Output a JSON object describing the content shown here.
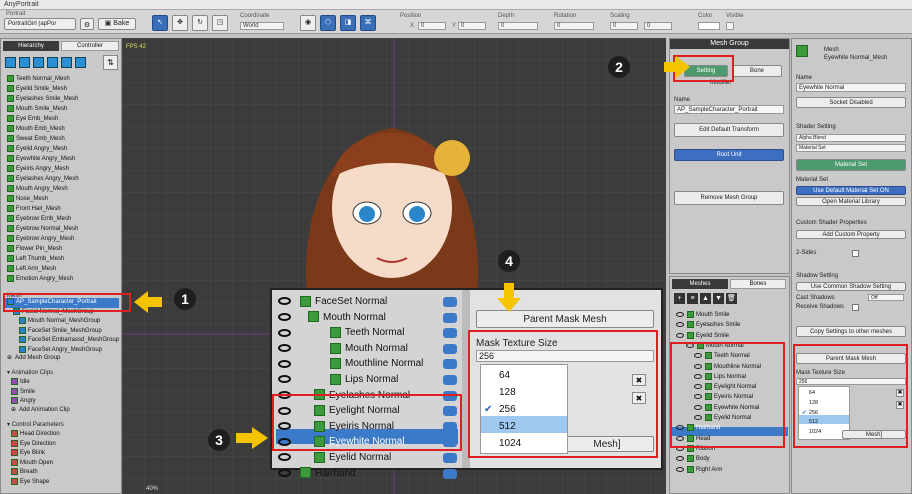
{
  "window_title": "AnyPortrait",
  "toolbar": {
    "portrait_select": "PortraitGirl (apPor",
    "bake": "Bake",
    "coordinate_label": "Coordinate",
    "coordinate_value": "World",
    "position_label": "Position",
    "depth_label": "Depth",
    "rotation_label": "Rotation",
    "scaling_label": "Scaling",
    "color_label": "Color",
    "visible_label": "Visible",
    "x": "X",
    "y": "Y",
    "zero": "0",
    "portrait_label": "Portrait"
  },
  "hierarchy": {
    "tabs": [
      "Hierarchy",
      "Controller"
    ],
    "meshes": [
      "Teeth Normal_Mesh",
      "Eyelid Smile_Mesh",
      "Eyelashes Smile_Mesh",
      "Mouth Smile_Mesh",
      "Eye Emb_Mesh",
      "Mouth Emb_Mesh",
      "Sweat Emb_Mesh",
      "Eyelid Angry_Mesh",
      "Eyewhite Angry_Mesh",
      "Eyeiris Angry_Mesh",
      "Eyelashes Angry_Mesh",
      "Mouth Angry_Mesh",
      "Nose_Mesh",
      "Front Hair_Mesh",
      "Eyebrow Emb_Mesh",
      "Eyebrow Normal_Mesh",
      "Eyebrow Angry_Mesh",
      "Flower Pin_Mesh",
      "Left Thumb_Mesh",
      "Left Arm_Mesh",
      "Emotion Angry_Mesh"
    ],
    "add_mesh": "Add Mesh",
    "mesh_groups_label": "Mesh Groups",
    "mesh_groups": [
      "AP_SampleCharacter_Portrait",
      "Facial Normal_MeshGroup",
      "Mouth Normal_MeshGroup",
      "FaceSet Smile_MeshGroup",
      "FaceSet Embarrassd_MeshGroup",
      "FaceSet Angry_MeshGroup"
    ],
    "add_mesh_group": "Add Mesh Group",
    "animation_clips_label": "Animation Clips",
    "animation_clips": [
      "Idle",
      "Smile",
      "Angry"
    ],
    "add_animation_clip": "Add Animation Clip",
    "control_params_label": "Control Parameters",
    "control_params": [
      "Head Direction",
      "Eye Direction",
      "Eye Blink",
      "Mouth Open",
      "Breath",
      "Eye Shape"
    ]
  },
  "viewport": {
    "fps": "FPS 42",
    "zoom": "40%"
  },
  "meshgroup_panel": {
    "title": "Mesh Group",
    "setting": "Setting",
    "bone": "Bone",
    "modifier": "Modifier",
    "name_label": "Name",
    "name_value": "AP_SampleCharacter_Portrait",
    "edit_default_transform": "Edit Default Transform",
    "root_unit": "Root Unit",
    "remove_mesh_group": "Remove Mesh Group"
  },
  "meshes_panel": {
    "tabs": [
      "Meshes",
      "Bones"
    ],
    "items": [
      "Mouth Smile",
      "Eyelashes Smile",
      "Eyelid Smile",
      "Mouth Normal",
      "Teeth Normal",
      "Mouthline Normal",
      "Lips Normal",
      "Eyelight Normal",
      "Eyeiris Normal",
      "Eyewhite Normal",
      "Eyelid Normal",
      "Hairband",
      "Head",
      "Ribbon",
      "Body",
      "Right Arm"
    ]
  },
  "inspector": {
    "type": "Mesh",
    "name_header": "Eyewhite Normal_Mesh",
    "name_label": "Name",
    "name_value": "Eyewhite Normal",
    "socket_disabled": "Socket Disabled",
    "shader_setting": "Shader Setting",
    "alpha_blend": "Alpha Blend",
    "material_set_dd": "Material Set",
    "material_set_btn": "Material Set",
    "material_set_label": "Material Set",
    "use_default": "Use Default Material Set ON",
    "open_library": "Open Material Library",
    "custom_shader": "Custom Shader Properties",
    "add_custom": "Add Custom Property",
    "two_sides": "2-Sides",
    "shadow_setting": "Shadow Setting",
    "use_common_shadow": "Use Common Shadow Setting",
    "cast_shadows": "Cast Shadows",
    "cast_value": "Off",
    "receive_shadows": "Receive Shadows",
    "copy_settings": "Copy Settings to other meshes",
    "parent_mask_mesh": "Parent Mask Mesh",
    "mask_texture_size": "Mask Texture Size",
    "mask_value": "256",
    "options": [
      "64",
      "128",
      "256",
      "512",
      "1024"
    ],
    "mesh_suffix": "Mesh]"
  },
  "zoom_inset": {
    "items": [
      "FaceSet Normal",
      "Mouth Normal",
      "Teeth Normal",
      "Mouth Normal",
      "Mouthline Normal",
      "Lips Normal",
      "Eyelashes Normal",
      "Eyelight Normal",
      "Eyeiris Normal",
      "Eyewhite Normal",
      "Eyelid Normal",
      "Hairband"
    ],
    "parent_mask_mesh": "Parent Mask Mesh",
    "mask_texture_size": "Mask Texture Size",
    "mask_value": "256",
    "options": [
      "64",
      "128",
      "256",
      "512",
      "1024"
    ],
    "mesh_suffix": "Mesh]"
  },
  "callouts": [
    "1",
    "2",
    "3",
    "4"
  ],
  "colors": {
    "red": "#e02020",
    "arrow": "#f5c400",
    "selection": "#3b79c9"
  }
}
